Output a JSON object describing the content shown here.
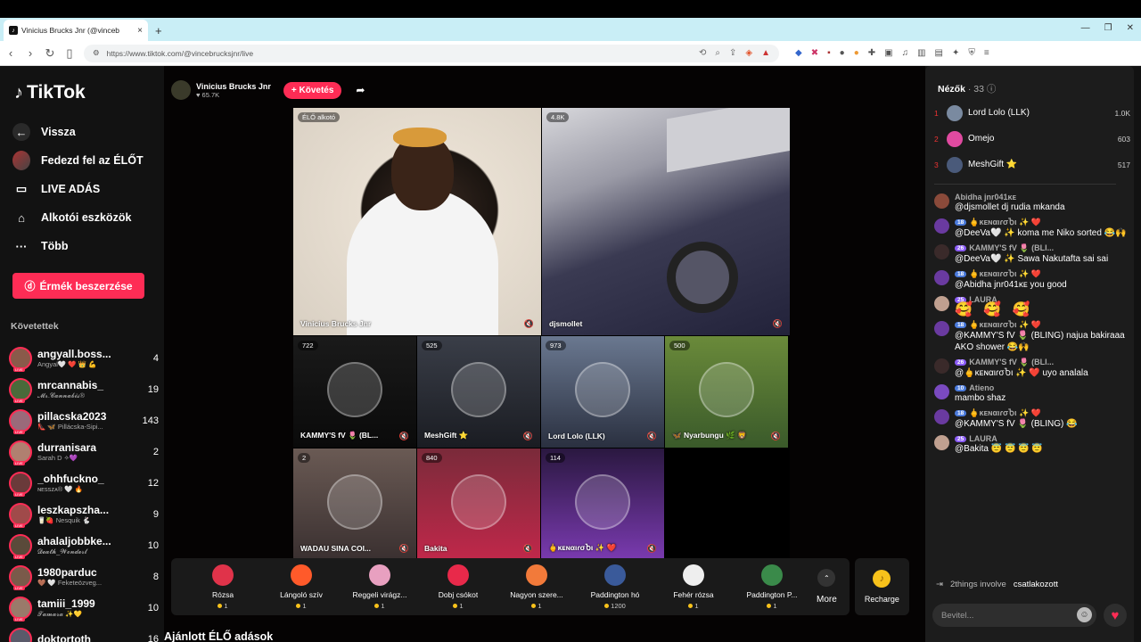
{
  "browser": {
    "tab_title": "Vinicius Brucks Jnr (@vinceb",
    "tab_close": "×",
    "new_tab": "+",
    "url": "https://www.tiktok.com/@vincebrucksjnr/live"
  },
  "sidebar": {
    "logo": "TikTok",
    "menu": [
      {
        "label": "Vissza",
        "icon": "arrow-left-icon"
      },
      {
        "label": "Fedezd fel az ÉLŐT",
        "icon": "avatar-icon"
      },
      {
        "label": "LIVE ADÁS",
        "icon": "live-camera-icon"
      },
      {
        "label": "Alkotói eszközök",
        "icon": "home-icon"
      },
      {
        "label": "Több",
        "icon": "more-dots-icon"
      }
    ],
    "buy_button": "Érmék beszerzése",
    "following_header": "Követettek",
    "following": [
      {
        "name": "angyall.boss...",
        "sub": "Angyal🤍 ❤️ 👑 💪",
        "count": "4",
        "color": "#8a5a4a"
      },
      {
        "name": "mrcannabis_",
        "sub": "𝓜𝓻.𝓒𝓪𝓷𝓷𝓪𝓫𝓲𝓼®",
        "count": "19",
        "color": "#4a6a3a"
      },
      {
        "name": "pillacska2023",
        "sub": "👠 🦋 Pillácska-Sipi...",
        "count": "143",
        "color": "#9a6a7a"
      },
      {
        "name": "durranisara",
        "sub": "Sarah D ✧💜",
        "count": "2",
        "color": "#b08070"
      },
      {
        "name": "_ohhfuckno_",
        "sub": "ɴᴇssᴢᴀ® 🤍 🔥",
        "count": "12",
        "color": "#6a3a3a"
      },
      {
        "name": "leszkapszha...",
        "sub": "🥛🍓 Nesquik 🐇",
        "count": "9",
        "color": "#a04a4a"
      },
      {
        "name": "ahalaljobbke...",
        "sub": "𝓓𝓮𝓪𝓽𝓱_𝓦𝓸𝓷𝓭𝓮𝓻𝓵",
        "count": "10",
        "color": "#5a4a3a"
      },
      {
        "name": "1980parduc",
        "sub": "🤎 🤍 Feketeözveg...",
        "count": "8",
        "color": "#7a5a4a"
      },
      {
        "name": "tamiii_1999",
        "sub": "𝓣𝓪𝓶𝓪𝓻𝓪 ✨💛",
        "count": "10",
        "color": "#9a7a6a"
      },
      {
        "name": "doktortoth",
        "sub": "",
        "count": "16",
        "color": "#5a5a6a"
      }
    ]
  },
  "host": {
    "name": "Vinicius Brucks Jnr",
    "likes": "♥ 65.7K",
    "follow": "+ Követés"
  },
  "video": {
    "main_left": {
      "badge": "ÉLŐ alkotó",
      "label": "Vinicius Brucks Jnr"
    },
    "main_right": {
      "badge": "4.8K",
      "label": "djsmollet"
    },
    "tiles": [
      {
        "badge": "722",
        "label": "KAMMY'S fV 🌷 (BL..."
      },
      {
        "badge": "525",
        "label": "MeshGift ⭐"
      },
      {
        "badge": "973",
        "label": "Lord Lolo (LLK)"
      },
      {
        "badge": "500",
        "label": "🦋 Nyarbungu 🌿 🦁"
      },
      {
        "badge": "2",
        "label": "WADAU SINA COI..."
      },
      {
        "badge": "840",
        "label": "Bakita"
      },
      {
        "badge": "114",
        "label": "🖕ĸᴇɴαιɾσႦι ✨ ❤️"
      }
    ]
  },
  "gifts": [
    {
      "name": "Rózsa",
      "price": "1",
      "color": "#e0334a"
    },
    {
      "name": "Lángoló szív",
      "price": "1",
      "color": "#ff5a2a"
    },
    {
      "name": "Reggeli virágz...",
      "price": "1",
      "color": "#e8a0c0"
    },
    {
      "name": "Dobj csókot",
      "price": "1",
      "color": "#e8294a"
    },
    {
      "name": "Nagyon szere...",
      "price": "1",
      "color": "#f27a3a"
    },
    {
      "name": "Paddington hó",
      "price": "1200",
      "color": "#3a5a9a"
    },
    {
      "name": "Fehér rózsa",
      "price": "1",
      "color": "#eeeeee"
    },
    {
      "name": "Paddington P...",
      "price": "1",
      "color": "#3a8a4a"
    }
  ],
  "more_label": "More",
  "recharge_label": "Recharge",
  "recommended": "Ajánlott ÉLŐ adások",
  "chat": {
    "viewers_label": "Nézők",
    "viewers_count": "· 33",
    "top_viewers": [
      {
        "rank": "1",
        "name": "Lord Lolo (LLK)",
        "score": "1.0K",
        "color": "#7a8aa0"
      },
      {
        "rank": "2",
        "name": "Omejo",
        "score": "603",
        "color": "#e04aa0"
      },
      {
        "rank": "3",
        "name": "MeshGift ⭐",
        "score": "517",
        "color": "#4a5a7a"
      }
    ],
    "messages": [
      {
        "user": "Abidha jnr041ᴋᴇ",
        "level": "",
        "text": "@djsmollet dj rudia mkanda",
        "color": "#8a4a3a"
      },
      {
        "user": "🖕ĸᴇɴαιɾσႦι ✨ ❤️",
        "level": "18",
        "text": "@DeeVa🤍 ✨ koma me Niko sorted 😂🙌",
        "color": "#6a3aa0"
      },
      {
        "user": "KAMMY'S fV 🌷 (BLI...",
        "level": "26",
        "text": "@DeeVa🤍 ✨ Sawa Nakutafta sai sai",
        "color": "#3a2a2a"
      },
      {
        "user": "🖕ĸᴇɴαιɾσႦι ✨ ❤️",
        "level": "18",
        "text": "@Abidha jnr041ᴋᴇ you good",
        "color": "#6a3aa0"
      },
      {
        "user": "LAURA",
        "level": "25",
        "text": "🥰 🥰 🥰",
        "color": "#c0a090"
      },
      {
        "user": "🖕ĸᴇɴαιɾσႦι ✨ ❤️",
        "level": "18",
        "text": "@KAMMY'S fV 🌷 (BLING) najua bakiraaa AKO shower 😂🙌",
        "color": "#6a3aa0"
      },
      {
        "user": "KAMMY'S fV 🌷 (BLI...",
        "level": "26",
        "text": "@🖕ĸᴇɴαιɾσႦι ✨ ❤️ uyo analala",
        "color": "#3a2a2a"
      },
      {
        "user": "Atieno",
        "level": "10",
        "text": "mambo shaz",
        "color": "#7a4ac0"
      },
      {
        "user": "🖕ĸᴇɴαιɾσႦι ✨ ❤️",
        "level": "18",
        "text": "@KAMMY'S fV 🌷 (BLING) 😂",
        "color": "#6a3aa0"
      },
      {
        "user": "LAURA",
        "level": "25",
        "text": "@Bakita 😇 😇 😇 😇",
        "color": "#c0a090"
      }
    ],
    "joined_user": "2things involve",
    "joined_text": "csatlakozott",
    "input_placeholder": "Bevitel..."
  }
}
